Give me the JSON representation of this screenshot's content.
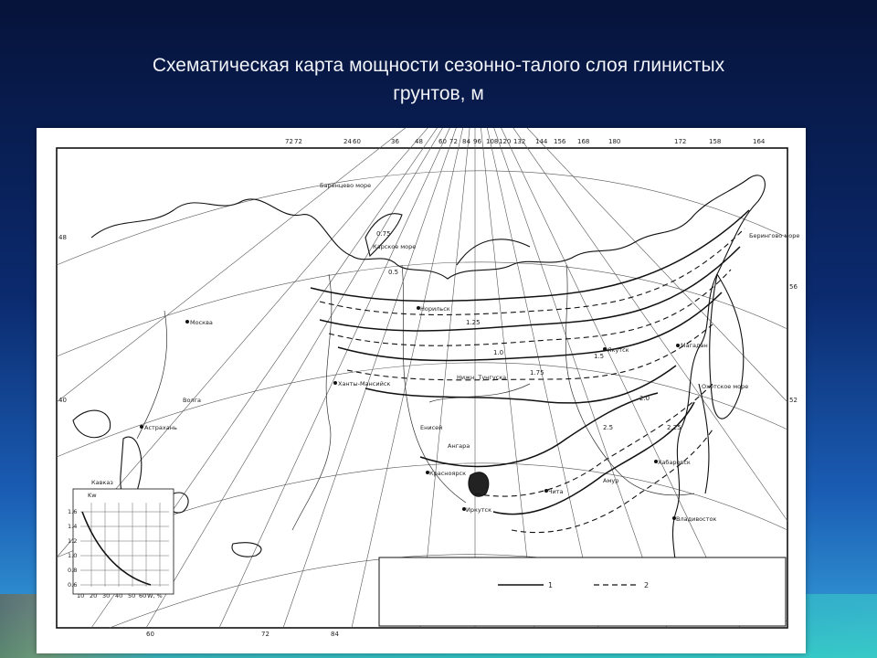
{
  "slide": {
    "title_line1": "Схематическая карта мощности сезонно-талого слоя глинистых",
    "title_line2": "грунтов, м"
  },
  "map": {
    "top_ticks": [
      "72",
      "72",
      "24",
      "60",
      "36",
      "48",
      "60",
      "72",
      "84",
      "96",
      "108",
      "120",
      "132",
      "144",
      "156",
      "168",
      "180",
      "172",
      "158",
      "164"
    ],
    "side_ticks": [
      "48",
      "40",
      "56",
      "52"
    ],
    "bottom_ticks": [
      "60",
      "72",
      "84"
    ],
    "isolines": [
      "0.5",
      "0.75",
      "1.0",
      "1.25",
      "1.5",
      "1.75",
      "2.0",
      "2.25",
      "2.5"
    ],
    "places": [
      "Москва",
      "Волга",
      "Астрахань",
      "Кавказ",
      "Иркутск",
      "Якутск",
      "Магадан",
      "Красноярск",
      "Чита",
      "Амур",
      "Хабаровск",
      "Владивосток",
      "Ханты-Мансийск",
      "Карское море",
      "Баренцево море",
      "Охотское море",
      "Берингово море",
      "Енисей",
      "Ангара",
      "Нижн. Тунгуска",
      "Норильск"
    ],
    "legend_item_1": "1",
    "legend_item_2": "2"
  },
  "inset_chart": {
    "y_axis_label": "Kw",
    "x_axis_label": "W, %",
    "y_ticks": [
      "1.6",
      "1.4",
      "1.2",
      "1.0",
      "0.8",
      "0.6"
    ],
    "x_ticks": [
      "10",
      "20",
      "30",
      "40",
      "50",
      "60"
    ]
  }
}
